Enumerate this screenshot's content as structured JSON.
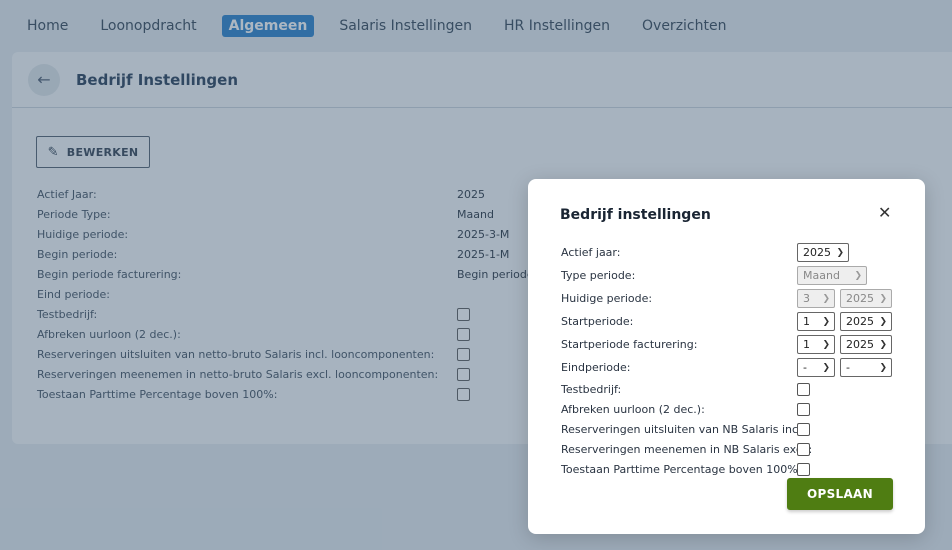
{
  "nav": {
    "items": [
      {
        "label": "Home"
      },
      {
        "label": "Loonopdracht"
      },
      {
        "label": "Algemeen",
        "active": true
      },
      {
        "label": "Salaris Instellingen"
      },
      {
        "label": "HR Instellingen"
      },
      {
        "label": "Overzichten"
      }
    ]
  },
  "page": {
    "title": "Bedrijf Instellingen",
    "back_icon": "arrow-left-icon",
    "edit_label": "BEWERKEN",
    "edit_icon": "pencil-icon",
    "info": [
      {
        "label": "Actief Jaar:",
        "value": "2025"
      },
      {
        "label": "Periode Type:",
        "value": "Maand"
      },
      {
        "label": "Huidige periode:",
        "value": "2025-3-M"
      },
      {
        "label": "Begin periode:",
        "value": "2025-1-M"
      },
      {
        "label": "Begin periode facturering:",
        "value": "Begin periode"
      },
      {
        "label": "Eind periode:",
        "value": ""
      },
      {
        "label": "Testbedrijf:",
        "checked": false
      },
      {
        "label": "Afbreken uurloon (2 dec.):",
        "checked": false
      },
      {
        "label": "Reserveringen uitsluiten van netto-bruto Salaris incl. looncomponenten:",
        "checked": false
      },
      {
        "label": "Reserveringen meenemen in netto-bruto Salaris excl. looncomponenten:",
        "checked": false
      },
      {
        "label": "Toestaan Parttime Percentage boven 100%:",
        "checked": false
      }
    ]
  },
  "modal": {
    "title": "Bedrijf instellingen",
    "close_icon": "close-icon",
    "fields": [
      {
        "label": "Actief jaar:",
        "selects": [
          {
            "value": "2025",
            "disabled": false
          }
        ]
      },
      {
        "label": "Type periode:",
        "selects": [
          {
            "value": "Maand",
            "disabled": true
          }
        ]
      },
      {
        "label": "Huidige periode:",
        "selects": [
          {
            "value": "3",
            "disabled": true
          },
          {
            "value": "2025",
            "disabled": true
          }
        ]
      },
      {
        "label": "Startperiode:",
        "selects": [
          {
            "value": "1",
            "disabled": false
          },
          {
            "value": "2025",
            "disabled": false
          }
        ]
      },
      {
        "label": "Startperiode facturering:",
        "selects": [
          {
            "value": "1",
            "disabled": false
          },
          {
            "value": "2025",
            "disabled": false
          }
        ]
      },
      {
        "label": "Eindperiode:",
        "selects": [
          {
            "value": "-",
            "disabled": false
          },
          {
            "value": "-",
            "disabled": false
          }
        ]
      }
    ],
    "checkboxes": [
      {
        "label": "Testbedrijf:",
        "checked": false
      },
      {
        "label": "Afbreken uurloon (2 dec.):",
        "checked": false
      },
      {
        "label": "Reserveringen uitsluiten van NB Salaris incl.:",
        "checked": false
      },
      {
        "label": "Reserveringen meenemen in NB Salaris excl.:",
        "checked": false
      },
      {
        "label": "Toestaan Parttime Percentage boven 100%:",
        "checked": false
      }
    ],
    "save_label": "OPSLAAN"
  }
}
